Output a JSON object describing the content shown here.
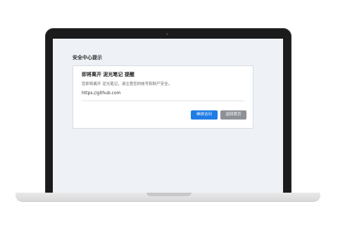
{
  "page": {
    "heading": "安全中心提示"
  },
  "notice": {
    "title": "即将离开 泥光笔记 提醒",
    "description": "您即将离开 泥光笔记，请注意您的帐号和财产安全。",
    "url": "https://github.com"
  },
  "actions": {
    "continue_label": "继续访问",
    "back_label": "返回首页"
  },
  "colors": {
    "primary_button": "#1e7ce6",
    "secondary_button": "#8e9297",
    "screen_background": "#eef1f5",
    "laptop_bezel": "#1b1b1c"
  }
}
